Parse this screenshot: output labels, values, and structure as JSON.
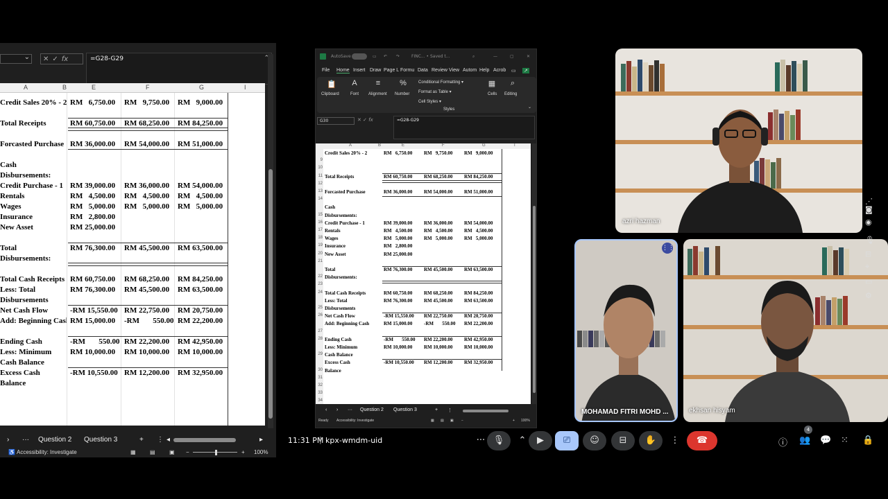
{
  "left_excel": {
    "formula": "=G28-G29",
    "column_headers": [
      "A",
      "B",
      "E",
      "F",
      "G",
      "I"
    ],
    "rows": [
      {
        "a": "Credit Sales 20% - 2",
        "e": "RM   6,750.00",
        "f": "RM   9,750.00",
        "g": "RM   9,000.00",
        "border": ""
      },
      {
        "a": "",
        "e": "",
        "f": "",
        "g": "",
        "border": ""
      },
      {
        "a": "Total Receipts",
        "e": "RM 60,750.00",
        "f": "RM 68,250.00",
        "g": "RM 84,250.00",
        "border": "line"
      },
      {
        "a": "",
        "e": "",
        "f": "",
        "g": "",
        "border": "dline"
      },
      {
        "a": "Forcasted Purchase",
        "e": "RM 36,000.00",
        "f": "RM 54,000.00",
        "g": "RM 51,000.00",
        "border": ""
      },
      {
        "a": "",
        "e": "",
        "f": "",
        "g": "",
        "border": "line"
      },
      {
        "a": "Cash",
        "e": "",
        "f": "",
        "g": "",
        "border": ""
      },
      {
        "a": "Disbursements:",
        "e": "",
        "f": "",
        "g": "",
        "border": ""
      },
      {
        "a": "Credit Purchase - 1",
        "e": "RM 39,000.00",
        "f": "RM 36,000.00",
        "g": "RM 54,000.00",
        "border": ""
      },
      {
        "a": "Rentals",
        "e": "RM   4,500.00",
        "f": "RM   4,500.00",
        "g": "RM   4,500.00",
        "border": ""
      },
      {
        "a": "Wages",
        "e": "RM   5,000.00",
        "f": "RM   5,000.00",
        "g": "RM   5,000.00",
        "border": ""
      },
      {
        "a": "Insurance",
        "e": "RM   2,800.00",
        "f": "",
        "g": "",
        "border": ""
      },
      {
        "a": "New Asset",
        "e": "RM 25,000.00",
        "f": "",
        "g": "",
        "border": ""
      },
      {
        "a": "",
        "e": "",
        "f": "",
        "g": "",
        "border": ""
      },
      {
        "a": "Total",
        "e": "RM 76,300.00",
        "f": "RM 45,500.00",
        "g": "RM 63,500.00",
        "border": "line"
      },
      {
        "a": "Disbursements:",
        "e": "",
        "f": "",
        "g": "",
        "border": ""
      },
      {
        "a": "",
        "e": "",
        "f": "",
        "g": "",
        "border": "dline"
      },
      {
        "a": "Total Cash Receipts",
        "e": "RM 60,750.00",
        "f": "RM 68,250.00",
        "g": "RM 84,250.00",
        "border": ""
      },
      {
        "a": "Less: Total",
        "e": "RM 76,300.00",
        "f": "RM 45,500.00",
        "g": "RM 63,500.00",
        "border": ""
      },
      {
        "a": "Disbursements",
        "e": "",
        "f": "",
        "g": "",
        "border": ""
      },
      {
        "a": "Net Cash Flow",
        "e": "-RM 15,550.00",
        "f": "RM 22,750.00",
        "g": "RM 20,750.00",
        "border": "line"
      },
      {
        "a": "Add: Beginning Cash",
        "e": "RM 15,000.00",
        "f": "-RM       550.00",
        "g": "RM 22,200.00",
        "border": ""
      },
      {
        "a": "",
        "e": "",
        "f": "",
        "g": "",
        "border": ""
      },
      {
        "a": "Ending Cash",
        "e": "-RM       550.00",
        "f": "RM 22,200.00",
        "g": "RM 42,950.00",
        "border": "line"
      },
      {
        "a": "Less: Minimum",
        "e": "RM 10,000.00",
        "f": "RM 10,000.00",
        "g": "RM 10,000.00",
        "border": ""
      },
      {
        "a": "Cash Balance",
        "e": "",
        "f": "",
        "g": "",
        "border": ""
      },
      {
        "a": "Excess Cash",
        "e": "-RM 10,550.00",
        "f": "RM 12,200.00",
        "g": "RM 32,950.00",
        "border": "line"
      },
      {
        "a": "Balance",
        "e": "",
        "f": "",
        "g": "",
        "border": ""
      }
    ],
    "tabs": [
      "Question 2",
      "Question 3"
    ],
    "status": "Accessibility: Investigate",
    "zoom": "100%"
  },
  "center_excel": {
    "title_autosave": "AutoSave",
    "title_file": "FINC... • Saved t...",
    "menu": [
      "File",
      "Home",
      "Insert",
      "Draw",
      "Page L",
      "Formu",
      "Data",
      "Review",
      "View",
      "Autom",
      "Help",
      "Acrob"
    ],
    "ribbon": {
      "clipboard": "Clipboard",
      "font": "Font",
      "alignment": "Alignment",
      "number": "Number",
      "cond_format": "Conditional Formatting ▾",
      "format_table": "Format as Table ▾",
      "cell_styles": "Cell Styles ▾",
      "styles": "Styles",
      "cells": "Cells",
      "editing": "Editing"
    },
    "namebox": "G30",
    "formula": "=G28-G29",
    "column_headers": [
      "A",
      "B",
      "E",
      "F",
      "G",
      "I"
    ],
    "rows": [
      {
        "n": "",
        "a": "Credit Sales 20% - 2",
        "e": "RM   6,750.00",
        "f": "RM   9,750.00",
        "g": "RM   9,000.00",
        "border": ""
      },
      {
        "n": "9",
        "a": "",
        "e": "",
        "f": "",
        "g": "",
        "border": ""
      },
      {
        "n": "10",
        "a": "",
        "e": "",
        "f": "",
        "g": "",
        "border": ""
      },
      {
        "n": "11",
        "a": "Total Receipts",
        "e": "RM 60,750.00",
        "f": "RM 68,250.00",
        "g": "RM 84,250.00",
        "border": "line"
      },
      {
        "n": "12",
        "a": "",
        "e": "",
        "f": "",
        "g": "",
        "border": "dline"
      },
      {
        "n": "13",
        "a": "Forcasted Purchase",
        "e": "RM 36,000.00",
        "f": "RM 54,000.00",
        "g": "RM 51,000.00",
        "border": ""
      },
      {
        "n": "14",
        "a": "",
        "e": "",
        "f": "",
        "g": "",
        "border": "line"
      },
      {
        "n": "",
        "a": "Cash",
        "e": "",
        "f": "",
        "g": "",
        "border": ""
      },
      {
        "n": "15",
        "a": "Disbursements:",
        "e": "",
        "f": "",
        "g": "",
        "border": ""
      },
      {
        "n": "16",
        "a": "Credit Purchase - 1",
        "e": "RM 39,000.00",
        "f": "RM 36,000.00",
        "g": "RM 54,000.00",
        "border": ""
      },
      {
        "n": "17",
        "a": "Rentals",
        "e": "RM   4,500.00",
        "f": "RM   4,500.00",
        "g": "RM   4,500.00",
        "border": ""
      },
      {
        "n": "18",
        "a": "Wages",
        "e": "RM   5,000.00",
        "f": "RM   5,000.00",
        "g": "RM   5,000.00",
        "border": ""
      },
      {
        "n": "19",
        "a": "Insurance",
        "e": "RM   2,800.00",
        "f": "",
        "g": "",
        "border": ""
      },
      {
        "n": "20",
        "a": "New Asset",
        "e": "RM 25,000.00",
        "f": "",
        "g": "",
        "border": ""
      },
      {
        "n": "21",
        "a": "",
        "e": "",
        "f": "",
        "g": "",
        "border": ""
      },
      {
        "n": "",
        "a": "Total",
        "e": "RM 76,300.00",
        "f": "RM 45,500.00",
        "g": "RM 63,500.00",
        "border": "line"
      },
      {
        "n": "22",
        "a": "Disbursements:",
        "e": "",
        "f": "",
        "g": "",
        "border": ""
      },
      {
        "n": "23",
        "a": "",
        "e": "",
        "f": "",
        "g": "",
        "border": "dline"
      },
      {
        "n": "24",
        "a": "Total Cash Receipts",
        "e": "RM 60,750.00",
        "f": "RM 68,250.00",
        "g": "RM 84,250.00",
        "border": ""
      },
      {
        "n": "",
        "a": "Less: Total",
        "e": "RM 76,300.00",
        "f": "RM 45,500.00",
        "g": "RM 63,500.00",
        "border": ""
      },
      {
        "n": "25",
        "a": "Disbursements",
        "e": "",
        "f": "",
        "g": "",
        "border": ""
      },
      {
        "n": "26",
        "a": "Net Cash Flow",
        "e": "-RM 15,550.00",
        "f": "RM 22,750.00",
        "g": "RM 20,750.00",
        "border": "line"
      },
      {
        "n": "",
        "a": "Add: Beginning Cash",
        "e": "RM 15,000.00",
        "f": "-RM       550.00",
        "g": "RM 22,200.00",
        "border": ""
      },
      {
        "n": "27",
        "a": "",
        "e": "",
        "f": "",
        "g": "",
        "border": ""
      },
      {
        "n": "28",
        "a": "Ending Cash",
        "e": "-RM       550.00",
        "f": "RM 22,200.00",
        "g": "RM 42,950.00",
        "border": "line"
      },
      {
        "n": "",
        "a": "Less: Minimum",
        "e": "RM 10,000.00",
        "f": "RM 10,000.00",
        "g": "RM 10,000.00",
        "border": ""
      },
      {
        "n": "29",
        "a": "Cash Balance",
        "e": "",
        "f": "",
        "g": "",
        "border": ""
      },
      {
        "n": "",
        "a": "Excess Cash",
        "e": "-RM 10,550.00",
        "f": "RM 12,200.00",
        "g": "RM 32,950.00",
        "border": "line"
      },
      {
        "n": "30",
        "a": "Balance",
        "e": "",
        "f": "",
        "g": "",
        "border": ""
      },
      {
        "n": "31",
        "a": "",
        "e": "",
        "f": "",
        "g": "",
        "border": ""
      },
      {
        "n": "32",
        "a": "",
        "e": "",
        "f": "",
        "g": "",
        "border": ""
      },
      {
        "n": "33",
        "a": "",
        "e": "",
        "f": "",
        "g": "",
        "border": ""
      },
      {
        "n": "34",
        "a": "",
        "e": "",
        "f": "",
        "g": "",
        "border": ""
      }
    ],
    "tabs": [
      "Question 2",
      "Question 3"
    ],
    "status_ready": "Ready",
    "status_access": "Accessibility: Investigate",
    "zoom": "100%"
  },
  "participants": {
    "azri": "azri hazman",
    "fitri": "MOHAMAD FITRI MOHD ...",
    "ekhsan": "ekhsan hisyam"
  },
  "meeting": {
    "time": "11:31 PM",
    "separator": "|",
    "code": "kpx-wmdm-uid",
    "people_count": "4"
  },
  "colors": {
    "meet_red": "#dc362e",
    "meet_blue": "#a8c7fa",
    "excel_green": "#1d7a44"
  }
}
